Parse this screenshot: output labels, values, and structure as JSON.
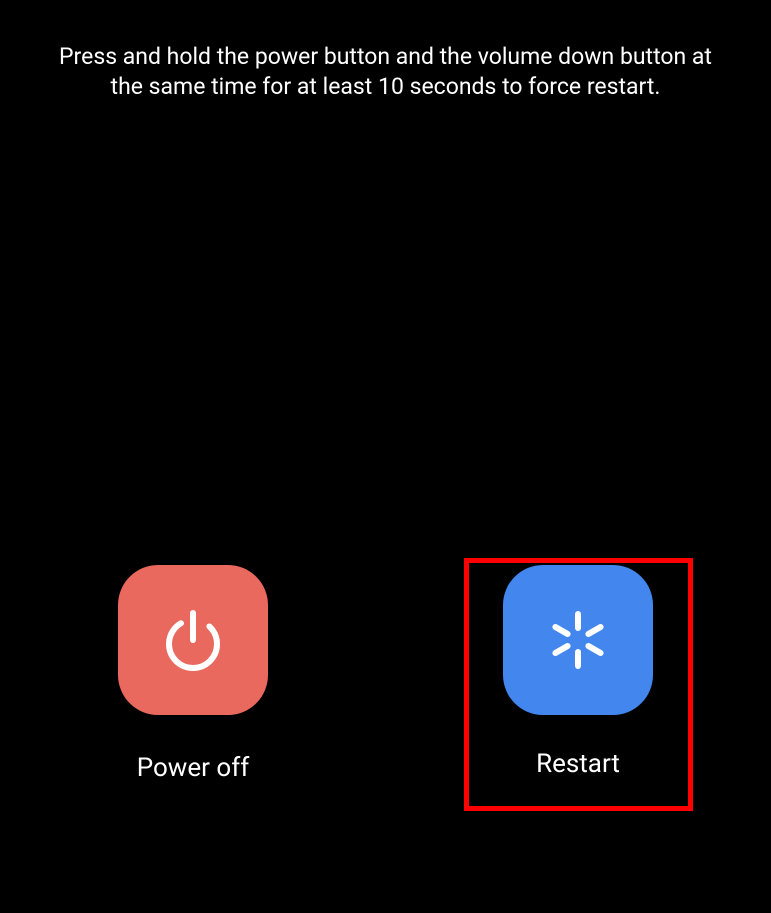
{
  "instruction": "Press and hold the power button and the volume down button at the same time for at least 10 seconds to force restart.",
  "actions": {
    "power_off": {
      "label": "Power off"
    },
    "restart": {
      "label": "Restart"
    }
  },
  "colors": {
    "power_off_bg": "#e9695f",
    "restart_bg": "#4286ee",
    "highlight_stroke": "#ff0000"
  }
}
